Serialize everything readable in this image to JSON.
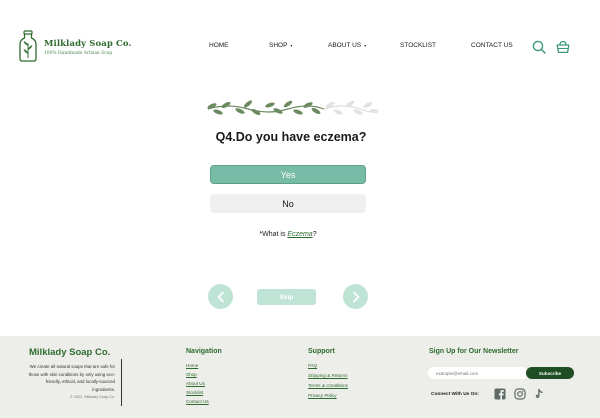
{
  "header": {
    "brand_name": "Milklady Soap Co.",
    "brand_tagline": "100% Handmade Artisan Soap",
    "nav": [
      {
        "label": "HOME"
      },
      {
        "label": "SHOP",
        "caret": "▾"
      },
      {
        "label": "ABOUT US",
        "caret": "▾"
      },
      {
        "label": "STOCKLIST"
      },
      {
        "label": "CONTACT US"
      }
    ],
    "icons": [
      "search-icon",
      "basket-icon"
    ]
  },
  "quiz": {
    "question": "Q4.Do you have eczema?",
    "answers": [
      "Yes",
      "No"
    ],
    "selected": "Yes",
    "info_prefix": "*What is ",
    "info_link": "Eczema",
    "info_suffix": "?",
    "skip_label": "Skip",
    "progress_leaves_active": 4,
    "progress_leaves_total": 6
  },
  "footer": {
    "brand": "Milklady Soap Co.",
    "description": "We create all-natural soaps that are safe for those with skin conditions by only using eco-friendly, ethical, and locally-sourced ingredients.",
    "copyright": "© 2022, Milklady Soap Co.",
    "navigation": {
      "title": "Navigation",
      "links": [
        "Home",
        "Shop",
        "About Us",
        "Stocklist",
        "Contact Us"
      ]
    },
    "support": {
      "title": "Support",
      "links": [
        "FAQ",
        "Shipping & Returns",
        "Terms & Conditions",
        "Privacy Policy"
      ]
    },
    "newsletter": {
      "title": "Sign Up for Our Newsletter",
      "placeholder": "example@email.com",
      "button": "Subscribe",
      "connect_label": "Connect With Us On:",
      "socials": [
        "facebook-icon",
        "instagram-icon",
        "tiktok-icon"
      ]
    }
  },
  "colors": {
    "brand_green": "#2e6b2f",
    "accent_teal": "#78bba6",
    "light_teal": "#bfe3d5",
    "footer_bg": "#ededea",
    "dark_green": "#1f4d24"
  }
}
